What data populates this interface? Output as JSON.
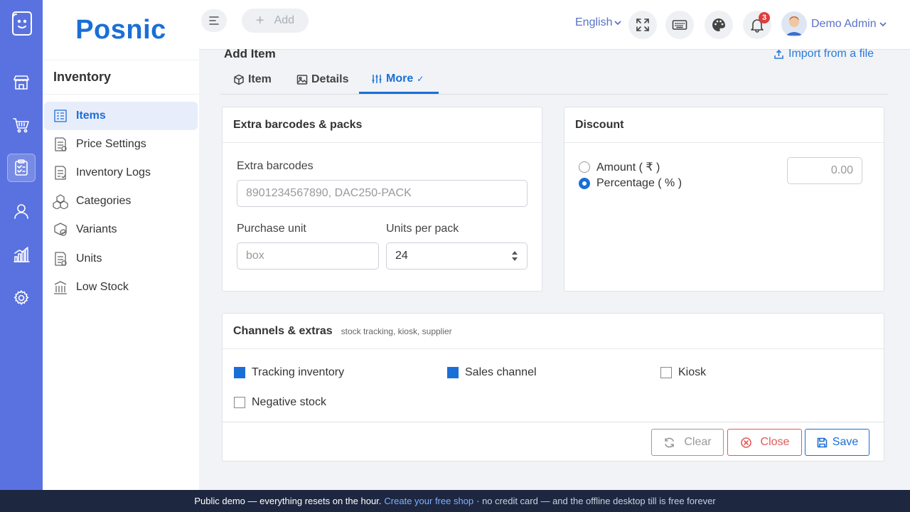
{
  "brand": {
    "name": "Posnic"
  },
  "rail": {
    "items": [
      {
        "name": "store-icon",
        "active": false
      },
      {
        "name": "cart-icon",
        "active": false
      },
      {
        "name": "clipboard-icon",
        "active": true
      },
      {
        "name": "user-icon",
        "active": false
      },
      {
        "name": "bar-chart-icon",
        "active": false
      },
      {
        "name": "gear-icon",
        "active": false
      }
    ]
  },
  "submenu": {
    "title": "Inventory",
    "items": [
      {
        "label": "Items",
        "icon": "items-icon",
        "active": true
      },
      {
        "label": "Price Settings",
        "icon": "price-settings-icon",
        "active": false
      },
      {
        "label": "Inventory Logs",
        "icon": "inventory-logs-icon",
        "active": false
      },
      {
        "label": "Categories",
        "icon": "categories-icon",
        "active": false
      },
      {
        "label": "Variants",
        "icon": "variants-icon",
        "active": false
      },
      {
        "label": "Units",
        "icon": "units-icon",
        "active": false
      },
      {
        "label": "Low Stock",
        "icon": "low-stock-icon",
        "active": false
      }
    ]
  },
  "header": {
    "add_label": "Add",
    "language": "English",
    "notification_count": "3",
    "user_name": "Demo Admin"
  },
  "page": {
    "title": "Add Item",
    "import_label": "Import from a file",
    "tabs": [
      {
        "label": "Item",
        "active": false
      },
      {
        "label": "Details",
        "active": false
      },
      {
        "label": "More",
        "active": true,
        "mark": "✓"
      }
    ]
  },
  "barcodes_card": {
    "title": "Extra barcodes & packs",
    "extra_barcodes_label": "Extra barcodes",
    "extra_barcodes_placeholder": "8901234567890, DAC250-PACK",
    "purchase_unit_label": "Purchase unit",
    "purchase_unit_placeholder": "box",
    "units_per_pack_label": "Units per pack",
    "units_per_pack_value": "24"
  },
  "discount_card": {
    "title": "Discount",
    "options": [
      {
        "label": "Amount ( ₹ )",
        "selected": false
      },
      {
        "label": "Percentage ( % )",
        "selected": true
      }
    ],
    "value_placeholder": "0.00"
  },
  "channels_card": {
    "title": "Channels & extras",
    "subtitle": "stock tracking, kiosk, supplier",
    "options": [
      {
        "label": "Tracking inventory",
        "checked": true
      },
      {
        "label": "Sales channel",
        "checked": true
      },
      {
        "label": "Kiosk",
        "checked": false
      },
      {
        "label": "Negative stock",
        "checked": false
      }
    ]
  },
  "actions": {
    "clear": "Clear",
    "close": "Close",
    "save": "Save"
  },
  "banner": {
    "lead": "Public demo — everything resets on the hour.",
    "link": "Create your free shop",
    "rest": "· no credit card — and the offline desktop till is free forever"
  },
  "colors": {
    "primary": "#1a6fd6",
    "rail": "#5a72e0",
    "danger": "#e05a5a",
    "banner": "#1e2740"
  }
}
